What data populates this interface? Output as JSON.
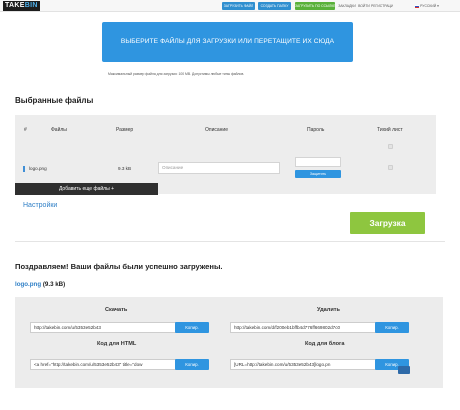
{
  "header": {
    "logo": {
      "part1": "TAKE",
      "part2": "BIN"
    },
    "nav_buttons": [
      "ЗАГРУЗИТЬ ФАЙЛ",
      "СОЗДАТЬ ПАПКУ",
      "ЗАГРУЗИТЬ ПО ССЫЛКЕ"
    ],
    "nav_links": [
      "ЗАКЛАДКИ",
      "ВОЙТИ",
      "РЕГИСТРАЦИЯ"
    ],
    "language": "РУССКИЙ ▾"
  },
  "dropzone": {
    "text": "ВЫБЕРИТЕ ФАЙЛЫ ДЛЯ ЗАГРУЗКИ ИЛИ ПЕРЕТАЩИТЕ ИХ СЮДА",
    "note": "Максимальный размер файла для загрузки: 100 MB. Допустимы любые типы файлов."
  },
  "selected": {
    "heading": "Выбранные файлы",
    "columns": [
      "#",
      "Файлы",
      "Размер",
      "Описание",
      "Пароль",
      "Тихий лист"
    ],
    "file": {
      "name": "logo.png",
      "size": "9.3 kB",
      "description_placeholder": "Описание"
    },
    "password_button": "Защитить",
    "add_more": "Добавить еще файлы +",
    "settings": "Настройки",
    "upload": "Загрузка"
  },
  "result": {
    "heading": "Поздравляем! Ваши файлы были успешно загружены.",
    "file_name": "logo.png",
    "file_size": "(9.3 kB)",
    "download": {
      "title": "Скачать",
      "value": "http://takebin.com/u/5353e52b43",
      "button": "Копир."
    },
    "delete": {
      "title": "Удалить",
      "value": "http://takebin.com/d/f200eb1bffb4d776ff669802d7c0",
      "button": "Копир."
    },
    "html": {
      "title": "Код для HTML",
      "value": "<a href=\"http://takebin.com/u/5353e52b43\" title=\"dow",
      "button": "Копир."
    },
    "blog": {
      "title": "Код для блога",
      "value": "[URL=http://takebin.com/u/5353e52b43]logo.pn",
      "button": "Копир."
    }
  },
  "colors": {
    "accent_blue": "#2f95e0",
    "upload_green": "#8ec63f",
    "nav_green": "#59b13a"
  }
}
